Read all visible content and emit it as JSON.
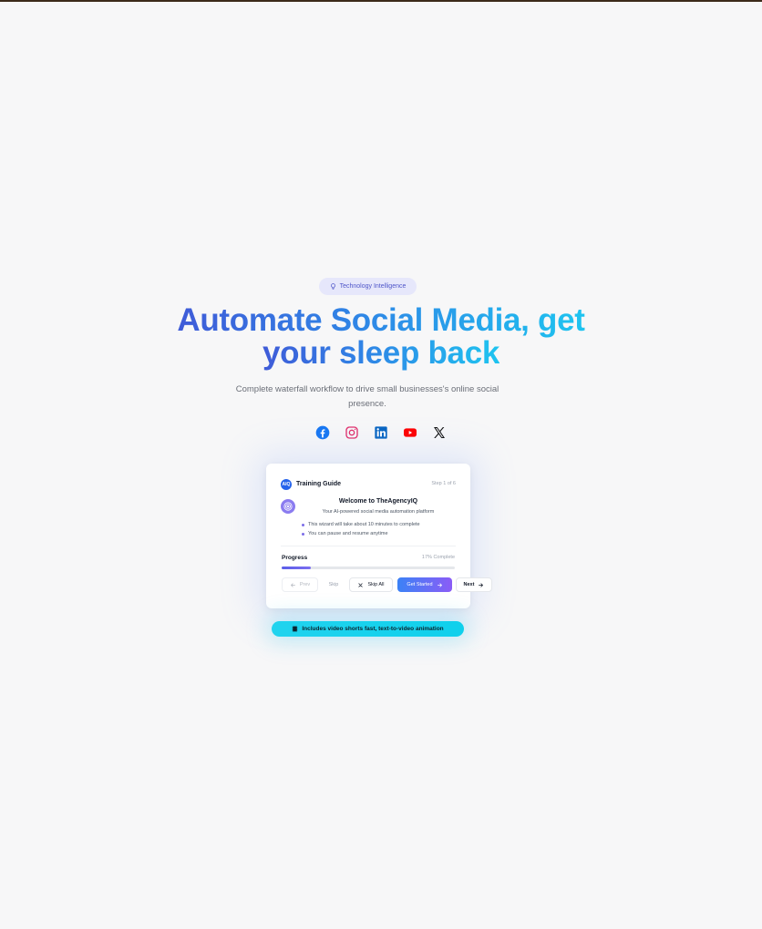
{
  "colors": {
    "accent": "#2563eb",
    "headline_gradient": [
      "#3f5bd8",
      "#2f86e6",
      "#1ec4f0"
    ],
    "badge_bg": "#e6e7fb",
    "pill_bg": "#21d3ee",
    "top_rule": "#3b2a1a"
  },
  "hero": {
    "badge": {
      "icon": "lightbulb-icon",
      "label": "Technology Intelligence"
    },
    "headline_line1": "Automate Social Media, get",
    "headline_line2": "your sleep back",
    "subtitle": "Complete waterfall workflow to drive small businesses's online social presence."
  },
  "socials": [
    {
      "icon": "facebook-icon",
      "label": "Facebook"
    },
    {
      "icon": "instagram-icon",
      "label": "Instagram"
    },
    {
      "icon": "linkedin-icon",
      "label": "LinkedIn"
    },
    {
      "icon": "youtube-icon",
      "label": "YouTube"
    },
    {
      "icon": "x-icon",
      "label": "X"
    }
  ],
  "guide": {
    "logo": "AIQ",
    "title": "Training Guide",
    "step": "Step 1 of 6",
    "welcome_title": "Welcome to TheAgencyIQ",
    "welcome_sub": "Your AI-powered social media automation platform",
    "bullets": [
      "This wizard will take about 10 minutes to complete",
      "You can pause and resume anytime"
    ],
    "progress_label": "Progress",
    "progress_text": "17% Complete",
    "progress_value": 0.17,
    "buttons": {
      "prev": "Prev",
      "skip": "Skip",
      "skip_all": "Skip All",
      "get_started": "Get Started",
      "next": "Next"
    }
  },
  "feature_pill": {
    "icon": "film-icon",
    "label": "Includes video shorts fast, text-to-video animation"
  }
}
